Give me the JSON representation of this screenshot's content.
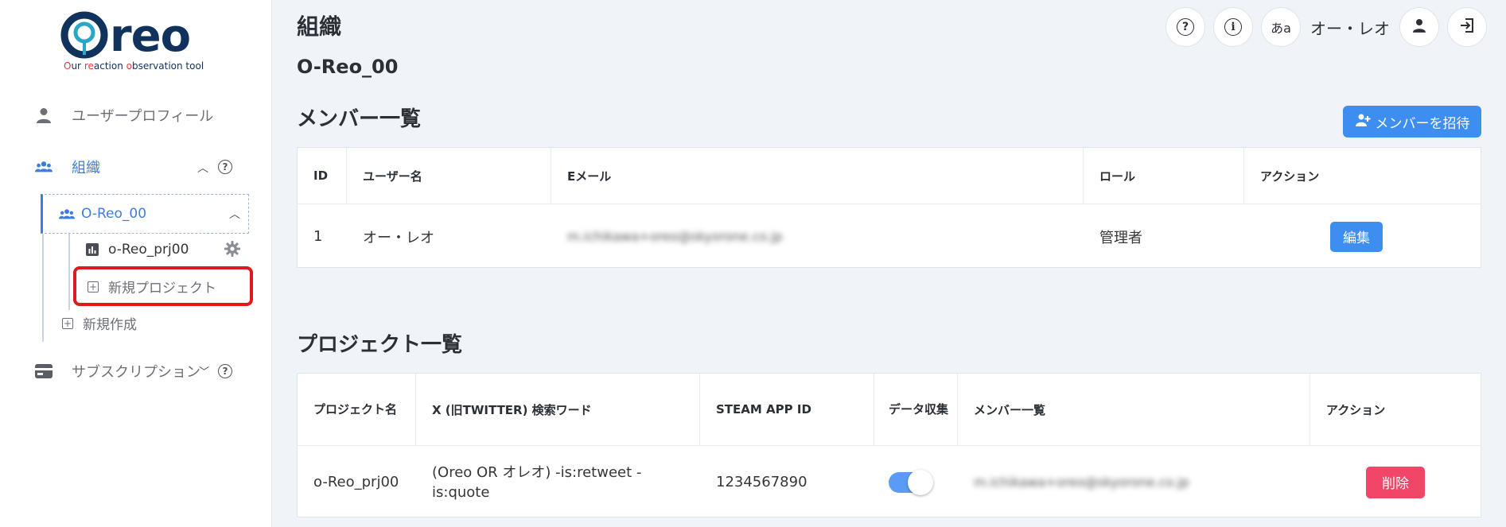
{
  "logo": {
    "text": "reo",
    "tagline_parts": [
      "O",
      "ur ",
      "re",
      "action ",
      "o",
      "bservation tool"
    ],
    "primary_color": "#10325c",
    "accent_color": "#2aa6c9"
  },
  "sidebar": {
    "user_profile": "ユーザープロフィール",
    "organization": "組織",
    "org_item": "O-Reo_00",
    "project_item": "o-Reo_prj00",
    "new_project": "新規プロジェクト",
    "new_create": "新規作成",
    "subscription": "サブスクリプション"
  },
  "header": {
    "title": "組織",
    "lang_label": "あa",
    "user_name": "オー・レオ"
  },
  "org_name": "O-Reo_00",
  "members": {
    "title": "メンバー一覧",
    "invite_label": "メンバーを招待",
    "columns": [
      "ID",
      "ユーザー名",
      "Eメール",
      "ロール",
      "アクション"
    ],
    "rows": [
      {
        "id": "1",
        "name": "オー・レオ",
        "email": "m.ichikawa+oreo@skyorone.co.jp",
        "role": "管理者",
        "action": "編集"
      }
    ]
  },
  "projects": {
    "title": "プロジェクト一覧",
    "columns": [
      "プロジェクト名",
      "X (旧TWITTER) 検索ワード",
      "STEAM APP ID",
      "データ収集",
      "メンバー一覧",
      "アクション"
    ],
    "rows": [
      {
        "name": "o-Reo_prj00",
        "search": "(Oreo OR オレオ) -is:retweet -is:quote",
        "steam_id": "1234567890",
        "collecting": true,
        "members": "m.ichikawa+oreo@skyorone.co.jp",
        "action": "削除"
      }
    ]
  },
  "colors": {
    "primary": "#3d8ef0",
    "danger": "#f14668",
    "active_nav": "#3c7ee0",
    "highlight": "#e0191c"
  }
}
